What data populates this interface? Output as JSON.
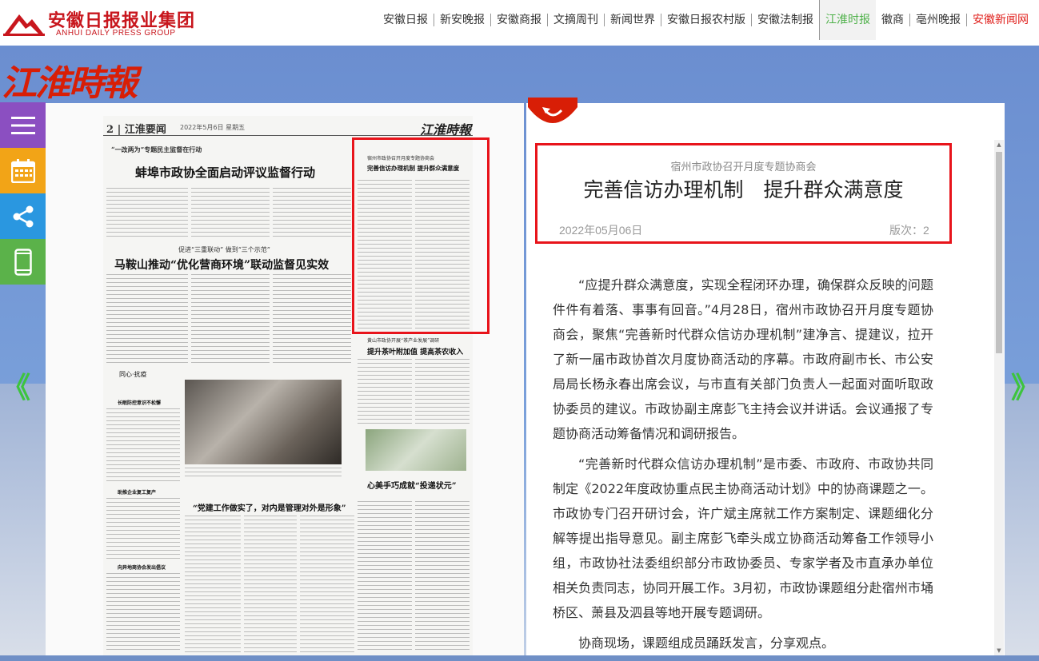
{
  "header": {
    "logo_cn": "安徽日报报业集团",
    "logo_en": "ANHUI DAILY PRESS GROUP",
    "nav": [
      {
        "label": "安徽日报",
        "state": "normal"
      },
      {
        "label": "新安晚报",
        "state": "normal"
      },
      {
        "label": "安徽商报",
        "state": "normal"
      },
      {
        "label": "文摘周刊",
        "state": "normal"
      },
      {
        "label": "新闻世界",
        "state": "normal"
      },
      {
        "label": "安徽日报农村版",
        "state": "normal"
      },
      {
        "label": "安徽法制报",
        "state": "normal"
      },
      {
        "label": "江淮时报",
        "state": "active"
      },
      {
        "label": "徽商",
        "state": "normal"
      },
      {
        "label": "亳州晚报",
        "state": "normal"
      },
      {
        "label": "安徽新闻网",
        "state": "red"
      }
    ]
  },
  "masthead": "江淮時報",
  "tools": {
    "menu_icon": "menu-icon",
    "calendar_icon": "calendar-icon",
    "share_icon": "share-icon",
    "mobile_icon": "mobile-icon"
  },
  "pager": {
    "prev": "《",
    "next": "》"
  },
  "newspaper": {
    "page_label": "2 | 江淮要闻",
    "page_date": "2022年5月6日  星期五",
    "page_masthead": "江淮時報",
    "headlines": [
      "“一改两为”专题民主监督在行动",
      "蚌埠市政协全面启动评议监督行动",
      "促进“三重联动”  做到“三个示范”",
      "马鞍山推动“优化营商环境”联动监督见实效",
      "宿州市政协召开月度专题协商会",
      "完善信访办理机制  提升群众满意度",
      "黄山市政协开展“茶产业发展”调研",
      "提升茶叶附加值  提高茶农收入",
      "“党建工作做实了，对内是管理对外是形象”",
      "心美手巧成就“投递状元”",
      "长眠防控意识不松懈",
      "助推企业复工复产",
      "向异地商协会发出倡议",
      "同心·抗疫"
    ]
  },
  "article": {
    "subtitle": "宿州市政协召开月度专题协商会",
    "title": "完善信访办理机制　提升群众满意度",
    "date": "2022年05月06日",
    "edition": "版次：2",
    "paragraphs": [
      "“应提升群众满意度，实现全程闭环办理，确保群众反映的问题件件有着落、事事有回音。”4月28日，宿州市政协召开月度专题协商会，聚焦“完善新时代群众信访办理机制”建净言、提建议，拉开了新一届市政协首次月度协商活动的序幕。市政府副市长、市公安局局长杨永春出席会议，与市直有关部门负责人一起面对面听取政协委员的建议。市政协副主席彭飞主持会议并讲话。会议通报了专题协商活动筹备情况和调研报告。",
      "“完善新时代群众信访办理机制”是市委、市政府、市政协共同制定《2022年度政协重点民主协商活动计划》中的协商课题之一。市政协专门召开研讨会，许广斌主席就工作方案制定、课题细化分解等提出指导意见。副主席彭飞牵头成立协商活动筹备工作领导小组，市政协社法委组织部分市政协委员、专家学者及市直承办单位相关负责同志，协同开展工作。3月初，市政协课题组分赴宿州市埇桥区、萧县及泗县等地开展专题调研。",
      "协商现场，课题组成员踊跃发言，分享观点。"
    ]
  }
}
